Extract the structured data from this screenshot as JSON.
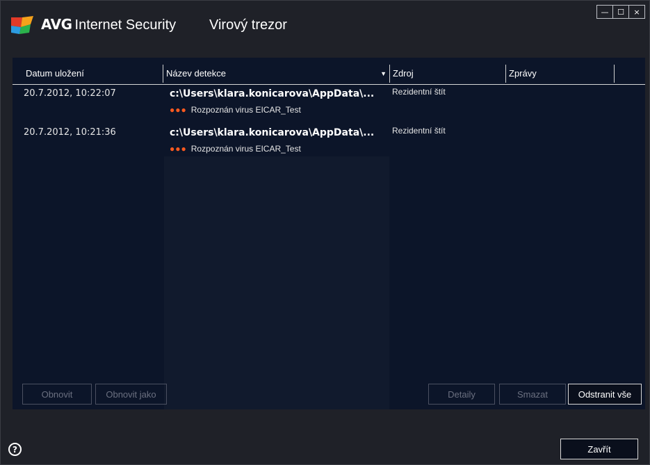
{
  "window": {
    "brand_bold": "AVG",
    "brand_rest": "Internet Security",
    "section_title": "Virový trezor",
    "minimize_glyph": "—",
    "maximize_glyph": "☐",
    "close_glyph": "×"
  },
  "columns": [
    {
      "label": "Datum uložení"
    },
    {
      "label": "Název detekce"
    },
    {
      "label": "Zdroj"
    },
    {
      "label": "Zprávy"
    }
  ],
  "rows": [
    {
      "date": "20.7.2012, 10:22:07",
      "path": "c:\\Users\\klara.konicarova\\AppData\\...",
      "detection": "Rozpoznán virus EICAR_Test",
      "source": "Rezidentní štít",
      "messages": ""
    },
    {
      "date": "20.7.2012, 10:21:36",
      "path": "c:\\Users\\klara.konicarova\\AppData\\...",
      "detection": "Rozpoznán virus EICAR_Test",
      "source": "Rezidentní štít",
      "messages": ""
    }
  ],
  "buttons": {
    "restore": "Obnovit",
    "restore_as": "Obnovit jako",
    "details": "Detaily",
    "delete": "Smazat",
    "delete_all": "Odstranit vše",
    "close": "Zavřít"
  },
  "icons": {
    "logo": "avg-logo-icon",
    "help": "help-icon",
    "severity": "severity-dots-icon",
    "sort": "sort-down-arrow-icon"
  },
  "colors": {
    "background": "#1f2128",
    "panel": "#0c1529",
    "severity": "#ff5a1f"
  }
}
